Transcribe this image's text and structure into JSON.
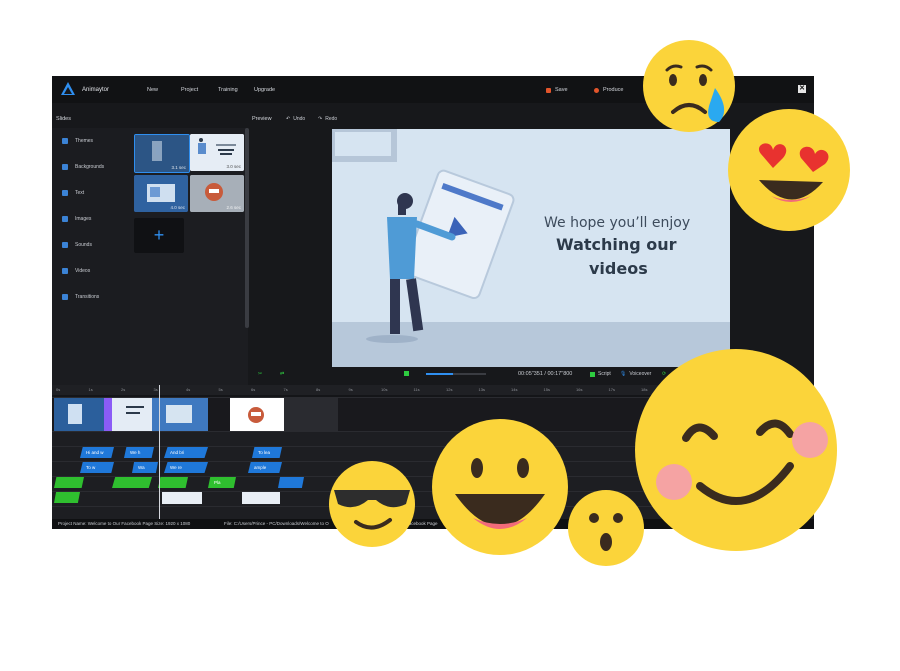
{
  "app": {
    "name": "Animaytor",
    "menu": [
      "New",
      "Project",
      "Training",
      "Upgrade"
    ],
    "save_label": "Save",
    "produce_label": "Produce",
    "close_glyph": "✕"
  },
  "slides_panel": {
    "title": "Slides",
    "sidebar": [
      {
        "label": "Themes"
      },
      {
        "label": "Backgrounds"
      },
      {
        "label": "Text"
      },
      {
        "label": "Images"
      },
      {
        "label": "Sounds"
      },
      {
        "label": "Videos"
      },
      {
        "label": "Transitions"
      }
    ],
    "thumbnails": [
      {
        "duration": "3.1 sec"
      },
      {
        "duration": "3.0 sec"
      },
      {
        "duration": "4.0 sec"
      },
      {
        "duration": "2.6 sec"
      }
    ],
    "add_glyph": "+"
  },
  "preview": {
    "title": "Preview",
    "undo": "Undo",
    "redo": "Redo",
    "stage_line1": "We hope you’ll enjoy",
    "stage_line2": "Watching our",
    "stage_line3": "videos"
  },
  "playback": {
    "time": "00:05\"351 / 00:17\"800",
    "progress": 0.45,
    "script": "Script",
    "voiceover": "Voiceover"
  },
  "timeline": {
    "ruler_ticks": [
      "0s",
      "1s",
      "2s",
      "3s",
      "4s",
      "5s",
      "6s",
      "7s",
      "8s",
      "9s",
      "10s",
      "11s",
      "12s",
      "13s",
      "14s",
      "15s",
      "16s",
      "17s",
      "18s",
      "19s",
      "20s",
      "21s",
      "22s"
    ],
    "text_row1": [
      "Hi and w",
      "We h",
      "And bri",
      "To lea"
    ],
    "text_row2": [
      "To w",
      "Wa",
      "We re",
      "ample"
    ],
    "green_row": [
      "Pla"
    ]
  },
  "statusbar": {
    "project_name": "Project Name: Welcome to Our Facebook Page  Size: 1920 x 1080",
    "file_path": "File: C:/Users/Prince - PC/Downloads/Welcome to O",
    "tail": "Facebook Page"
  },
  "colors": {
    "accent": "#2f8ff0",
    "app_bg": "#17181b",
    "produce": "#e2552b",
    "emoji_yellow": "#fbd43a"
  }
}
